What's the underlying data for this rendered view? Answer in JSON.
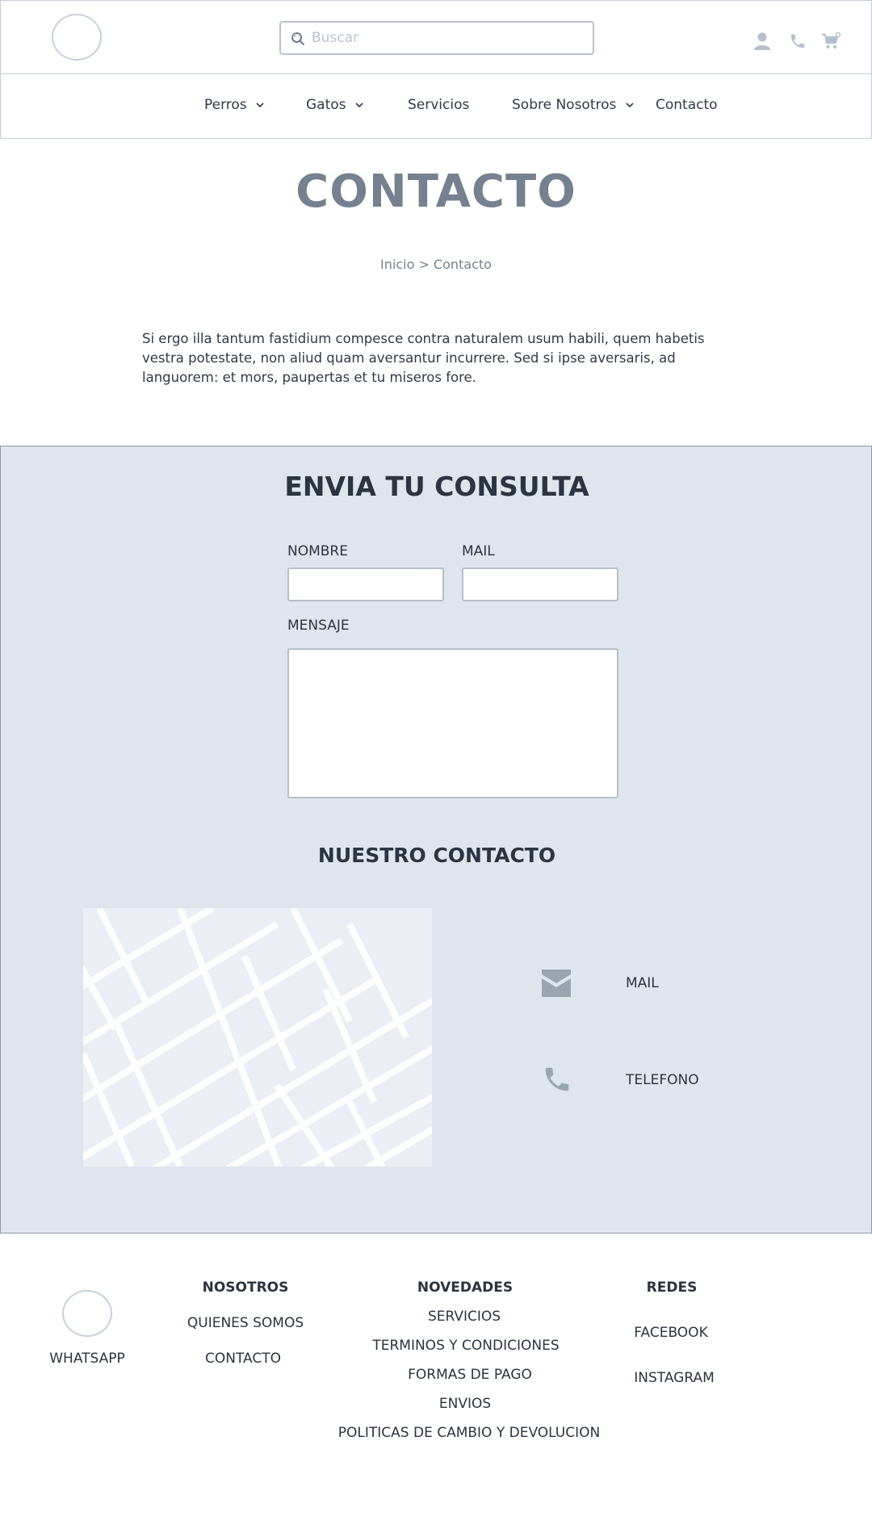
{
  "header": {
    "search_placeholder": "Buscar"
  },
  "nav": {
    "items": [
      {
        "label": "Perros",
        "has_dropdown": true
      },
      {
        "label": "Gatos",
        "has_dropdown": true
      },
      {
        "label": "Servicios",
        "has_dropdown": false
      },
      {
        "label": "Sobre Nosotros",
        "has_dropdown": true
      },
      {
        "label": "Contacto",
        "has_dropdown": false
      }
    ]
  },
  "hero": {
    "title": "CONTACTO",
    "breadcrumb": "Inicio > Contacto",
    "intro": "Si ergo illa tantum fastidium compesce contra naturalem usum habili, quem habetis vestra potestate, non aliud quam aversantur incurrere. Sed si ipse aversaris, ad languorem: et mors, paupertas et tu miseros fore."
  },
  "form": {
    "title": "ENVIA TU CONSULTA",
    "name_label": "NOMBRE",
    "mail_label": "MAIL",
    "message_label": "MENSAJE"
  },
  "our_contact": {
    "title": "NUESTRO CONTACTO",
    "mail_label": "MAIL",
    "phone_label": "TELEFONO"
  },
  "footer": {
    "whatsapp": "WHATSAPP",
    "nosotros": {
      "heading": "NOSOTROS",
      "links": [
        "QUIENES SOMOS",
        "CONTACTO"
      ]
    },
    "novedades": {
      "heading": "NOVEDADES",
      "links": [
        "SERVICIOS",
        "TERMINOS Y CONDICIONES",
        "FORMAS DE PAGO",
        "ENVIOS",
        "POLITICAS DE CAMBIO Y DEVOLUCION"
      ]
    },
    "redes": {
      "heading": "REDES",
      "links": [
        "FACEBOOK",
        "INSTAGRAM"
      ]
    }
  },
  "colors": {
    "accent_text": "#76818f",
    "section_bg": "#dfe5ed",
    "icon_gray": "#b5c0cc"
  },
  "icons": [
    "search-icon",
    "user-icon",
    "phone-icon",
    "cart-icon",
    "chevron-down-icon",
    "mail-icon",
    "phone-icon"
  ]
}
